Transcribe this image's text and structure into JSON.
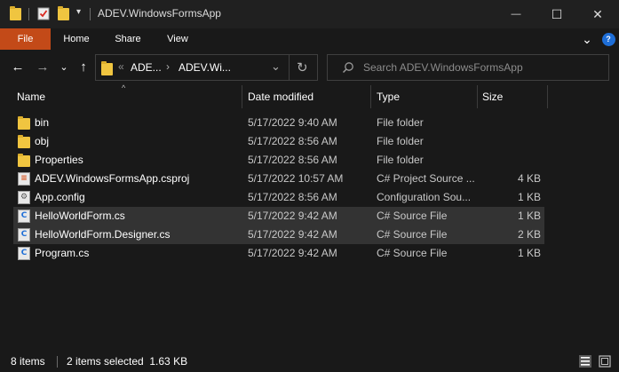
{
  "window": {
    "title": "ADEV.WindowsFormsApp",
    "minimize_glyph": "—",
    "maximize_glyph": "☐",
    "close_glyph": "✕"
  },
  "quick_access": {
    "dropdown_glyph": "▾"
  },
  "ribbon": {
    "tabs": [
      {
        "label": "File"
      },
      {
        "label": "Home"
      },
      {
        "label": "Share"
      },
      {
        "label": "View"
      }
    ],
    "expand_glyph": "⌄",
    "help_glyph": "?"
  },
  "navigation": {
    "back_glyph": "←",
    "forward_glyph": "→",
    "recent_glyph": "⌄",
    "up_glyph": "↑",
    "overflow_glyph": "«",
    "breadcrumb": [
      "ADE...",
      "ADEV.Wi..."
    ],
    "separator_glyph": "›",
    "dropdown_glyph": "⌄",
    "refresh_glyph": "↻"
  },
  "search": {
    "placeholder": "Search ADEV.WindowsFormsApp"
  },
  "columns": {
    "name": "Name",
    "date": "Date modified",
    "type": "Type",
    "size": "Size",
    "sorted_column": "Name",
    "sort_glyph": "^"
  },
  "files": [
    {
      "name": "bin",
      "date": "5/17/2022 9:40 AM",
      "type": "File folder",
      "size": "",
      "icon": "folder-icon",
      "selected": false
    },
    {
      "name": "obj",
      "date": "5/17/2022 8:56 AM",
      "type": "File folder",
      "size": "",
      "icon": "folder-icon",
      "selected": false
    },
    {
      "name": "Properties",
      "date": "5/17/2022 8:56 AM",
      "type": "File folder",
      "size": "",
      "icon": "folder-icon",
      "selected": false
    },
    {
      "name": "ADEV.WindowsFormsApp.csproj",
      "date": "5/17/2022 10:57 AM",
      "type": "C# Project Source ...",
      "size": "4 KB",
      "icon": "csproj-icon",
      "selected": false
    },
    {
      "name": "App.config",
      "date": "5/17/2022 8:56 AM",
      "type": "Configuration Sou...",
      "size": "1 KB",
      "icon": "config-file-icon",
      "selected": false
    },
    {
      "name": "HelloWorldForm.cs",
      "date": "5/17/2022 9:42 AM",
      "type": "C# Source File",
      "size": "1 KB",
      "icon": "csharp-file-icon",
      "selected": true
    },
    {
      "name": "HelloWorldForm.Designer.cs",
      "date": "5/17/2022 9:42 AM",
      "type": "C# Source File",
      "size": "2 KB",
      "icon": "csharp-file-icon",
      "selected": true
    },
    {
      "name": "Program.cs",
      "date": "5/17/2022 9:42 AM",
      "type": "C# Source File",
      "size": "1 KB",
      "icon": "csharp-file-icon",
      "selected": false
    }
  ],
  "status": {
    "item_count": "8 items",
    "selection": "2 items selected  1.63 KB"
  },
  "colors": {
    "background": "#191919",
    "titlebar": "#202020",
    "file_tab": "#c34a18",
    "selected_row": "#333333",
    "folder": "#f0c540",
    "csharp_icon": "#1e6ed7",
    "csproj_icon": "#d9531e",
    "help_button": "#1e6ed7"
  }
}
